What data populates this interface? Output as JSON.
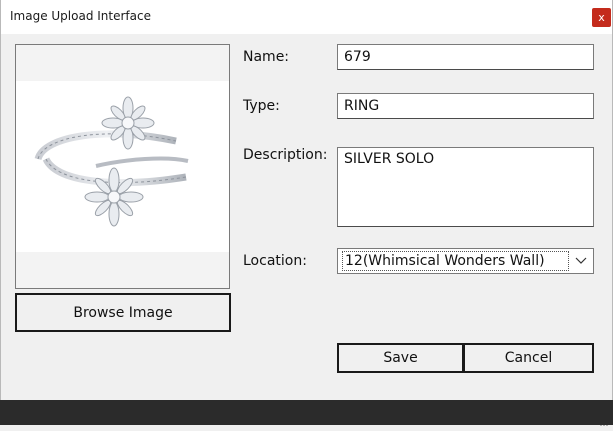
{
  "window": {
    "title": "Image Upload Interface",
    "close_glyph": "x"
  },
  "image_panel": {
    "image_subject": "diamond bypass ring with two star-shaped clusters",
    "browse_label": "Browse Image"
  },
  "form": {
    "name_label": "Name:",
    "name_value": "679",
    "type_label": "Type:",
    "type_value": "RING",
    "description_label": "Description:",
    "description_value": "SILVER SOLO",
    "location_label": "Location:",
    "location_value": "12(Whimsical Wonders Wall)"
  },
  "actions": {
    "save_label": "Save",
    "cancel_label": "Cancel"
  },
  "colors": {
    "close_button": "#c42b1c",
    "window_bg": "#f0f0f0",
    "taskbar": "#2b2b2b"
  }
}
